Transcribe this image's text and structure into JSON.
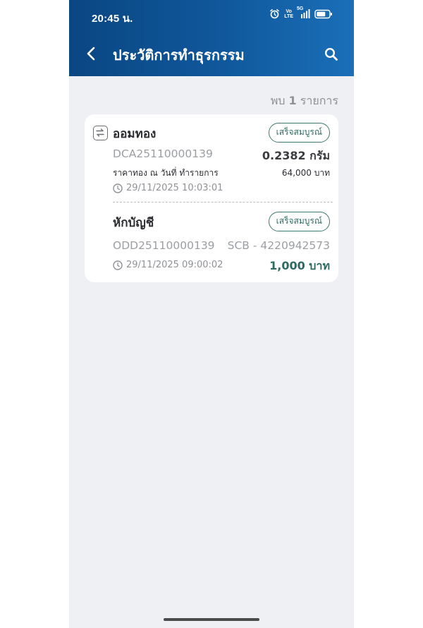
{
  "status_bar": {
    "time": "20:45 น.",
    "network_top": "Vo",
    "network_bottom": "LTE",
    "signal_label": "5G",
    "icons": [
      "alarm-icon",
      "volte-icon",
      "signal-icon",
      "battery-icon"
    ]
  },
  "header": {
    "title": "ประวัติการทำธุรกรรม",
    "back_icon": "chevron-left-icon",
    "search_icon": "search-icon"
  },
  "results": {
    "prefix": "พบ",
    "count": "1",
    "suffix": "รายการ"
  },
  "transactions": [
    {
      "title": "ออมทอง",
      "status": "เสร็จสมบูรณ์",
      "ref": "DCA25110000139",
      "amount": "0.2382 กรัม",
      "price_label": "ราคาทอง ณ วันที่ ทำรายการ",
      "price_value": "64,000 บาท",
      "datetime": "29/11/2025 10:03:01"
    },
    {
      "title": "หักบัญชี",
      "status": "เสร็จสมบูรณ์",
      "ref": "ODD25110000139",
      "account": "SCB - 4220942573",
      "datetime": "29/11/2025 09:00:02",
      "amount": "1,000 บาท"
    }
  ],
  "colors": {
    "header_start": "#0a4682",
    "header_end": "#1a6fb8",
    "background": "#eef0f3",
    "accent_green": "#2e6a62"
  }
}
